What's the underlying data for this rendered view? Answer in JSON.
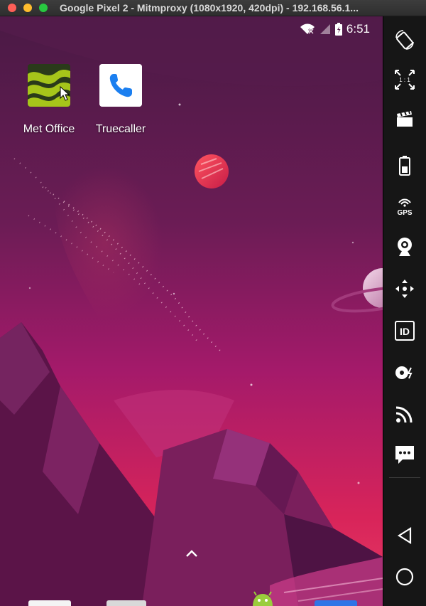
{
  "window": {
    "title": "Google Pixel 2 - Mitmproxy (1080x1920, 420dpi) - 192.168.56.1..."
  },
  "status_bar": {
    "time": "6:51",
    "icons": [
      "wifi-off-icon",
      "signal-icon",
      "battery-icon"
    ]
  },
  "home": {
    "apps": [
      {
        "label": "Met Office",
        "icon": "met-office-icon"
      },
      {
        "label": "Truecaller",
        "icon": "truecaller-phone-icon"
      }
    ],
    "app_drawer_hint": "chevron-up-icon",
    "dock_icons": [
      "dock-icon-white",
      "dock-icon-gray",
      "android-icon",
      "dock-icon-blue"
    ]
  },
  "toolbar": {
    "items": [
      {
        "name": "rotate",
        "icon": "rotate-icon"
      },
      {
        "name": "pixel-perfect",
        "icon": "scale-1-1-icon",
        "text": "1 : 1"
      },
      {
        "name": "screencast",
        "icon": "clapperboard-icon"
      },
      {
        "name": "battery",
        "icon": "battery-icon"
      },
      {
        "name": "gps",
        "icon": "gps-icon",
        "text": "GPS"
      },
      {
        "name": "camera",
        "icon": "webcam-icon"
      },
      {
        "name": "remote-control",
        "icon": "move-arrows-icon"
      },
      {
        "name": "identifiers",
        "icon": "id-icon",
        "text": "ID"
      },
      {
        "name": "disk-io",
        "icon": "disk-icon"
      },
      {
        "name": "network",
        "icon": "wifi-rss-icon"
      },
      {
        "name": "sms",
        "icon": "sms-icon"
      },
      {
        "name": "back",
        "icon": "back-triangle-icon"
      },
      {
        "name": "home",
        "icon": "home-circle-icon"
      }
    ]
  },
  "colors": {
    "wallpaper_top": "#4a1a45",
    "wallpaper_mid": "#a41a6a",
    "wallpaper_bottom": "#d8245a",
    "met_office_green": "#a6c51a",
    "truecaller_blue": "#1b7ff0",
    "planet_red": "#e83a56",
    "sidebar_bg": "#161616"
  }
}
